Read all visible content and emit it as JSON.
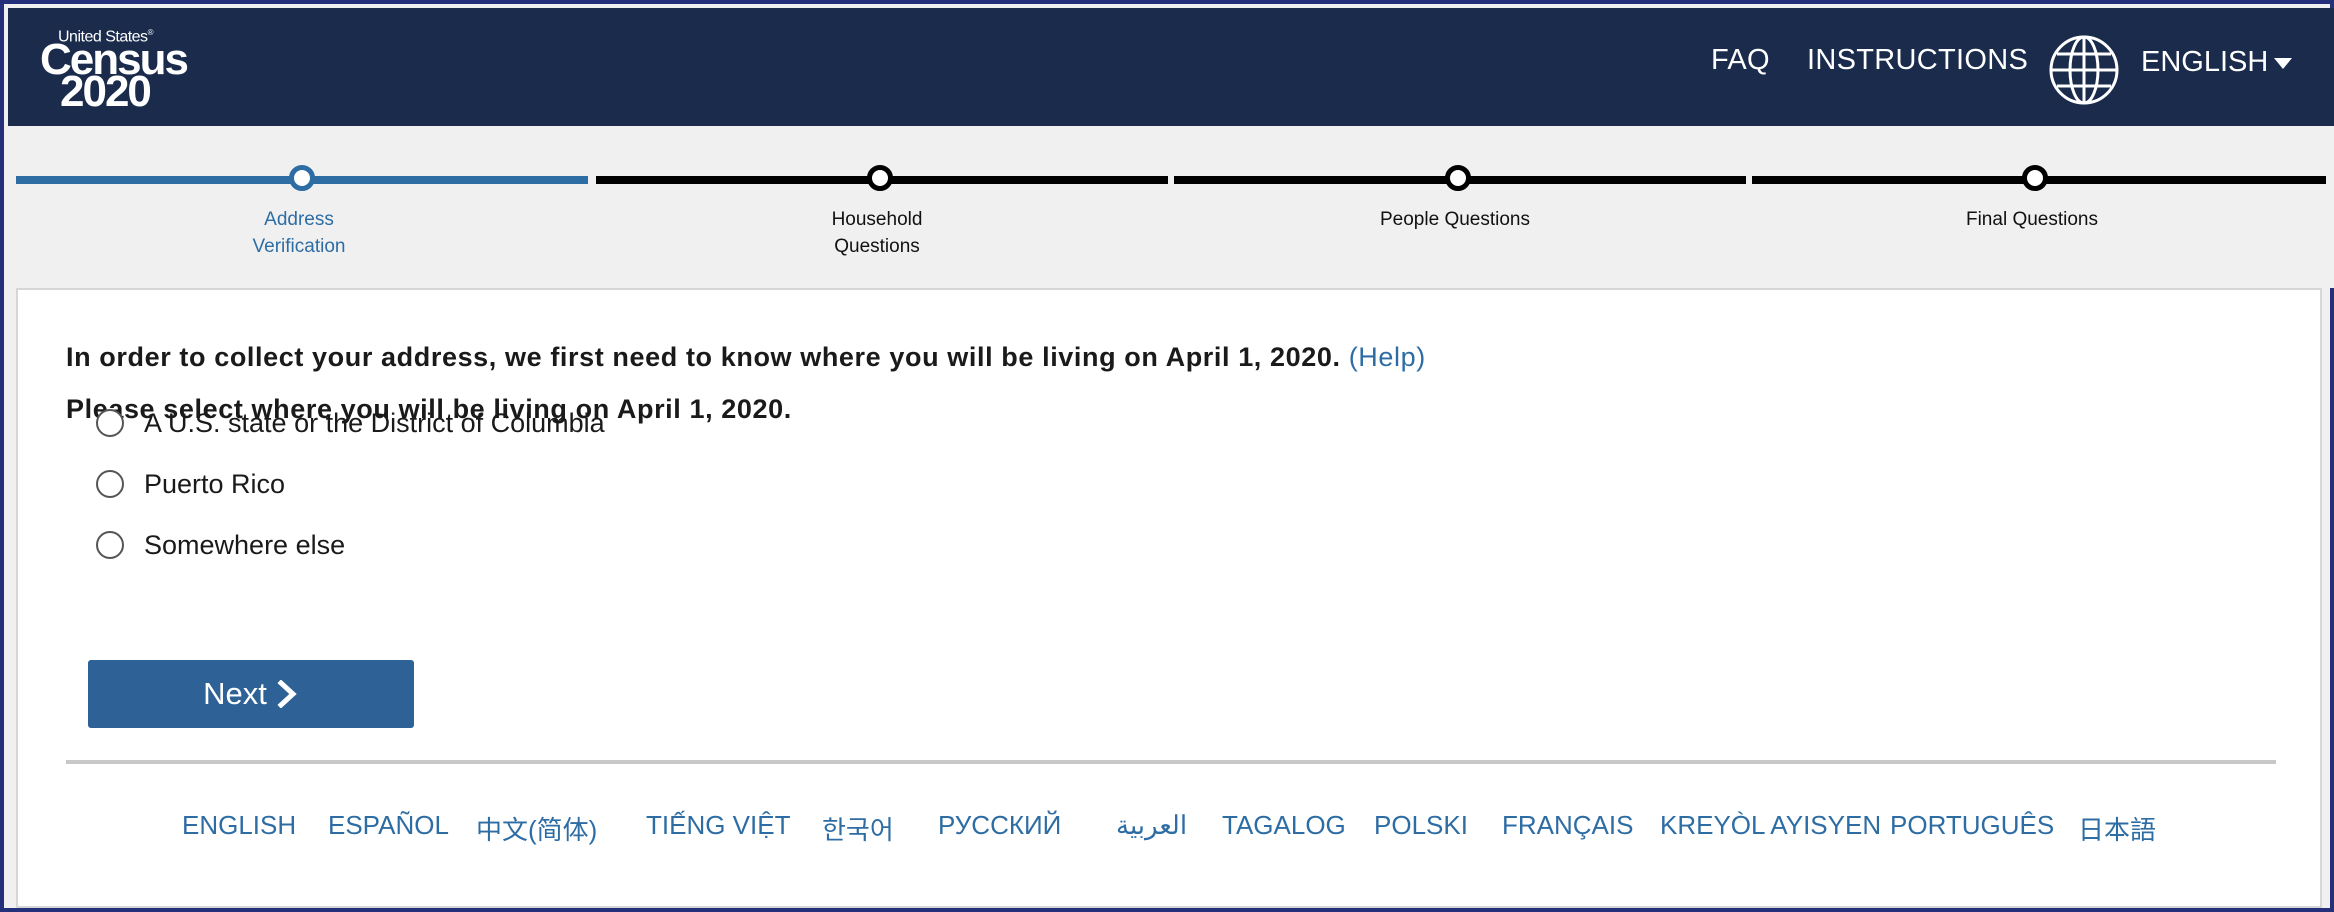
{
  "header": {
    "logo": {
      "top": "United States",
      "mark": "®",
      "name": "Census",
      "year": "2020"
    },
    "nav": {
      "faq": "FAQ",
      "instructions": "INSTRUCTIONS"
    },
    "language": "ENGLISH",
    "icons": {
      "globe": "globe-icon",
      "caret": "caret-down-icon"
    }
  },
  "progress": {
    "steps": [
      {
        "line1": "Address",
        "line2": "Verification",
        "active": true
      },
      {
        "line1": "Household",
        "line2": "Questions",
        "active": false
      },
      {
        "line1": "People Questions",
        "line2": "",
        "active": false
      },
      {
        "line1": "Final Questions",
        "line2": "",
        "active": false
      }
    ]
  },
  "question": {
    "intro": "In order to collect your address, we first need to know where you will be living on April 1, 2020.",
    "help": "(Help)",
    "prompt": "Please select where you will be living on April 1, 2020.",
    "options": [
      "A U.S. state or the District of Columbia",
      "Puerto Rico",
      "Somewhere else"
    ],
    "next": "Next"
  },
  "footer_languages": [
    "ENGLISH",
    "ESPAÑOL",
    "中文(简体)",
    "TIẾNG VIỆT",
    "한국어",
    "РУССКИЙ",
    "العربية",
    "TAGALOG",
    "POLSKI",
    "FRANÇAIS",
    "KREYÒL AYISYEN",
    "PORTUGUÊS",
    "日本語"
  ],
  "colors": {
    "header": "#1a2b4c",
    "accent": "#2e6da4",
    "button": "#2e6195"
  }
}
